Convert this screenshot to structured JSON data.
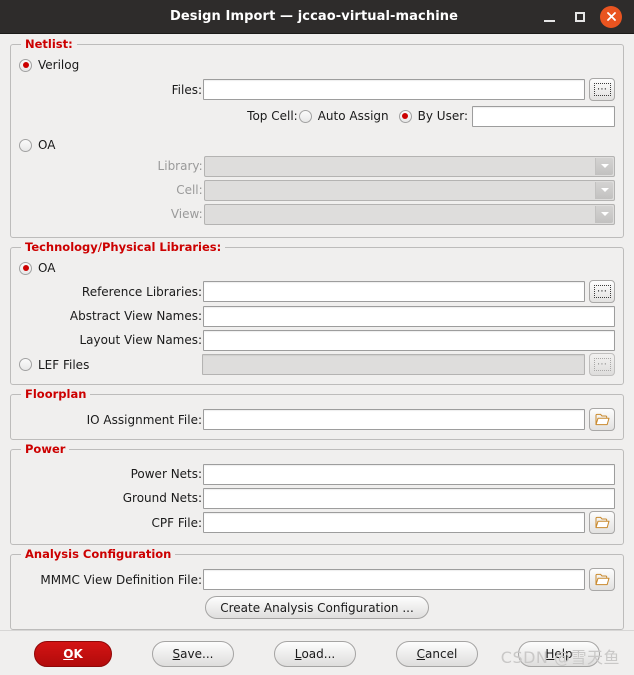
{
  "window": {
    "title": "Design Import — jccao-virtual-machine",
    "minimize_label": "Minimize",
    "maximize_label": "Maximize",
    "close_label": "Close"
  },
  "netlist": {
    "group_title": "Netlist:",
    "verilog_label": "Verilog",
    "files_label": "Files:",
    "files_value": "",
    "files_browse_label": "...",
    "top_cell_label": "Top Cell:",
    "auto_assign_label": "Auto Assign",
    "by_user_label": "By User:",
    "by_user_value": "",
    "oa_label": "OA",
    "library_label": "Library:",
    "library_value": "",
    "cell_label": "Cell:",
    "cell_value": "",
    "view_label": "View:",
    "view_value": ""
  },
  "technology": {
    "group_title": "Technology/Physical Libraries:",
    "oa_label": "OA",
    "reference_libraries_label": "Reference Libraries:",
    "reference_libraries_value": "",
    "abstract_view_names_label": "Abstract View Names:",
    "abstract_view_names_value": "",
    "layout_view_names_label": "Layout View Names:",
    "layout_view_names_value": "",
    "lef_files_label": "LEF Files",
    "lef_files_value": "",
    "browse_label": "..."
  },
  "floorplan": {
    "group_title": "Floorplan",
    "io_assignment_file_label": "IO Assignment File:",
    "io_assignment_file_value": ""
  },
  "power": {
    "group_title": "Power",
    "power_nets_label": "Power Nets:",
    "power_nets_value": "",
    "ground_nets_label": "Ground Nets:",
    "ground_nets_value": "",
    "cpf_file_label": "CPF File:",
    "cpf_file_value": ""
  },
  "analysis": {
    "group_title": "Analysis Configuration",
    "mmmc_label": "MMMC View Definition File:",
    "mmmc_value": "",
    "create_button_label": "Create Analysis Configuration ..."
  },
  "footer": {
    "ok_label": "OK",
    "ok_mnemonic": "O",
    "ok_rest": "K",
    "save_mnemonic": "S",
    "save_rest": "ave...",
    "load_mnemonic": "L",
    "load_rest": "oad...",
    "cancel_mnemonic": "C",
    "cancel_rest": "ancel",
    "help_mnemonic": "H",
    "help_rest": "elp",
    "watermark": "CSDN @雪天鱼"
  },
  "icons": {
    "folder_open": "folder-open-icon",
    "ellipsis": "ellipsis-icon",
    "chevron_down": "chevron-down-icon"
  },
  "colors": {
    "group_title": "#cc0000",
    "radio_selected": "#cc0000",
    "primary_button": "#c41212",
    "close_button": "#e95420",
    "titlebar": "#2e2c2b",
    "background": "#f0efee"
  }
}
